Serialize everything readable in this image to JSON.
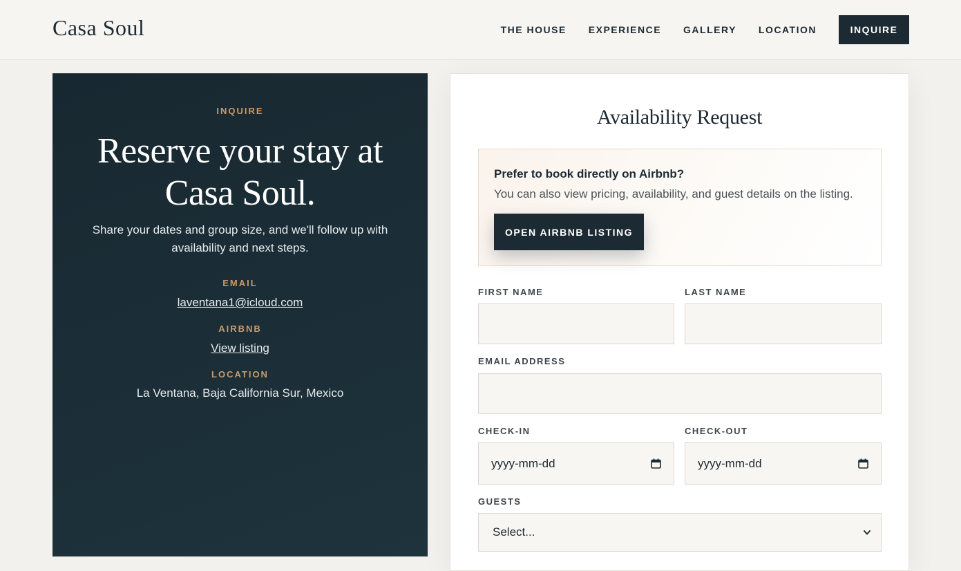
{
  "header": {
    "logo": "Casa Soul",
    "nav": [
      "THE HOUSE",
      "EXPERIENCE",
      "GALLERY",
      "LOCATION"
    ],
    "cta": "INQUIRE"
  },
  "intro": {
    "eyebrow": "INQUIRE",
    "title": "Reserve your stay at Casa Soul.",
    "subtitle": "Share your dates and group size, and we'll follow up with availability and next steps.",
    "email_label": "EMAIL",
    "email_value": "laventana1@icloud.com",
    "airbnb_label": "AIRBNB",
    "airbnb_value": "View listing",
    "location_label": "LOCATION",
    "location_value": "La Ventana, Baja California Sur, Mexico"
  },
  "form": {
    "title": "Availability Request",
    "airbnb_box": {
      "title": "Prefer to book directly on Airbnb?",
      "text": "You can also view pricing, availability, and guest details on the listing.",
      "button": "OPEN AIRBNB LISTING"
    },
    "first_name_label": "FIRST NAME",
    "last_name_label": "LAST NAME",
    "email_label": "EMAIL ADDRESS",
    "checkin_label": "CHECK-IN",
    "checkout_label": "CHECK-OUT",
    "date_placeholder": "yyyy-mm-dd",
    "guests_label": "GUESTS",
    "guests_selected": "Select..."
  },
  "colors": {
    "primary": "#1c2b33",
    "accent": "#c99a6b",
    "background": "#f3f1ee"
  },
  "icons": [
    "calendar-icon",
    "chevron-down-icon"
  ]
}
